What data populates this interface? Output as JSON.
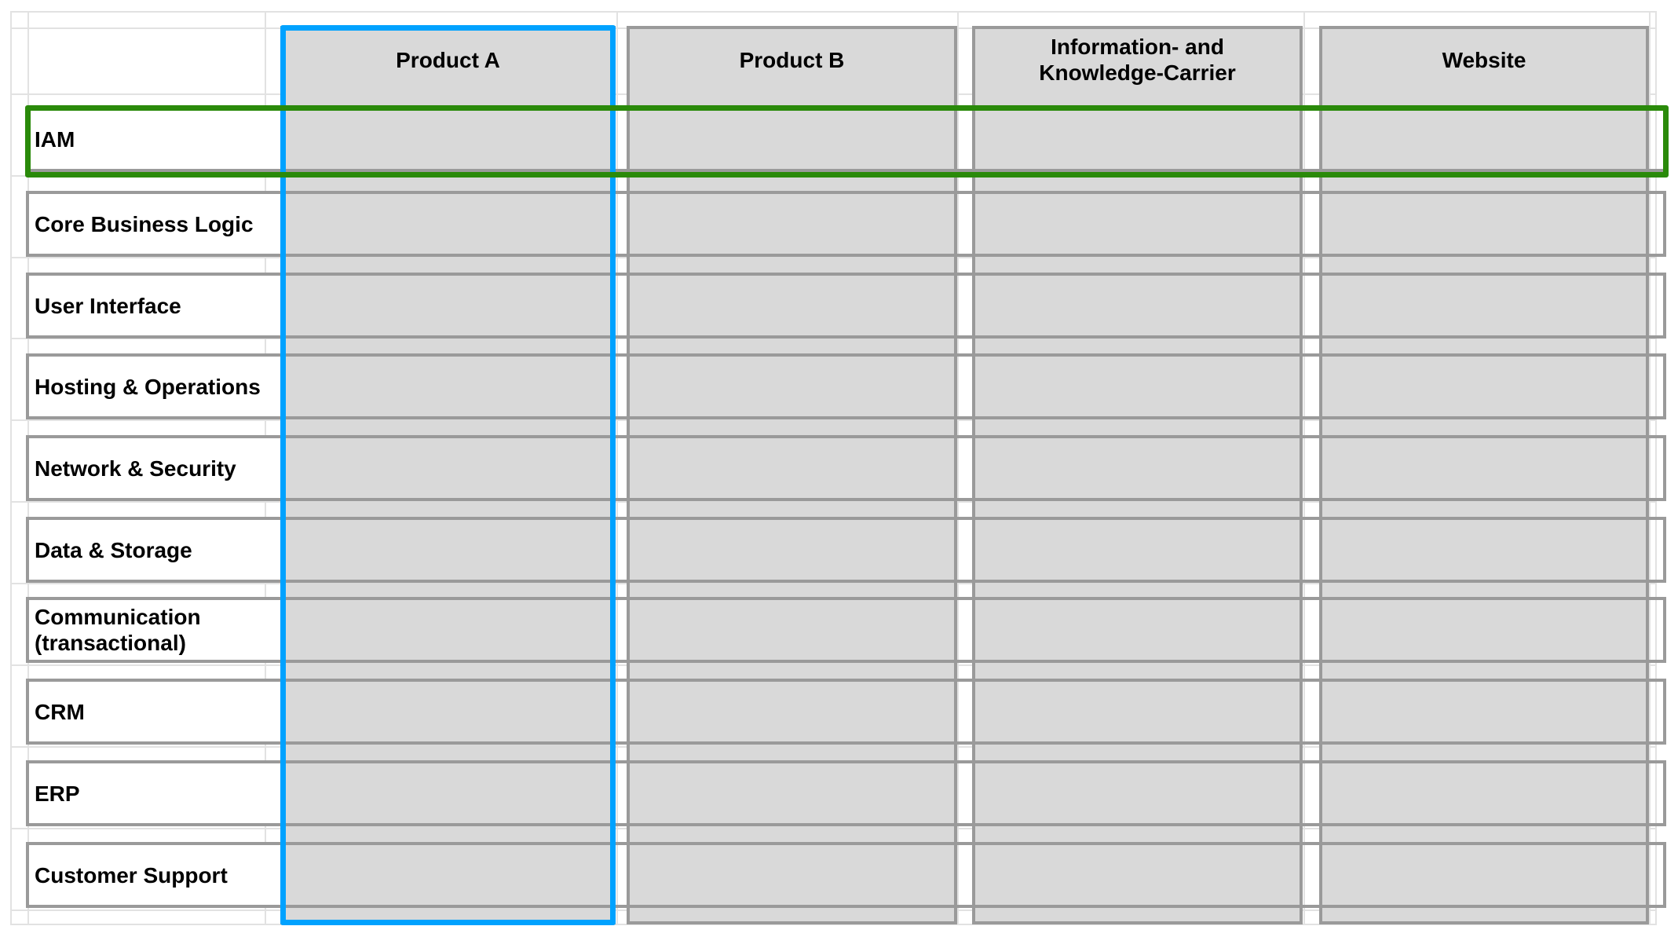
{
  "columns": [
    {
      "label": "Product A"
    },
    {
      "label": "Product B"
    },
    {
      "label": "Information- and Knowledge-Carrier"
    },
    {
      "label": "Website"
    }
  ],
  "rows": [
    {
      "label": "IAM"
    },
    {
      "label": "Core Business Logic"
    },
    {
      "label": "User Interface"
    },
    {
      "label": "Hosting & Operations"
    },
    {
      "label": "Network & Security"
    },
    {
      "label": "Data & Storage"
    },
    {
      "label": "Communication (transactional)"
    },
    {
      "label": "CRM"
    },
    {
      "label": "ERP"
    },
    {
      "label": "Customer Support"
    }
  ],
  "highlights": {
    "column": {
      "target": "Product A",
      "color": "#00a2ff"
    },
    "row": {
      "target": "IAM",
      "color": "#2a8a0a"
    }
  },
  "colors": {
    "cell_fill": "#d9d9d9",
    "cell_border": "#9a9a9a",
    "sheet_grid": "#e2e2e2"
  }
}
